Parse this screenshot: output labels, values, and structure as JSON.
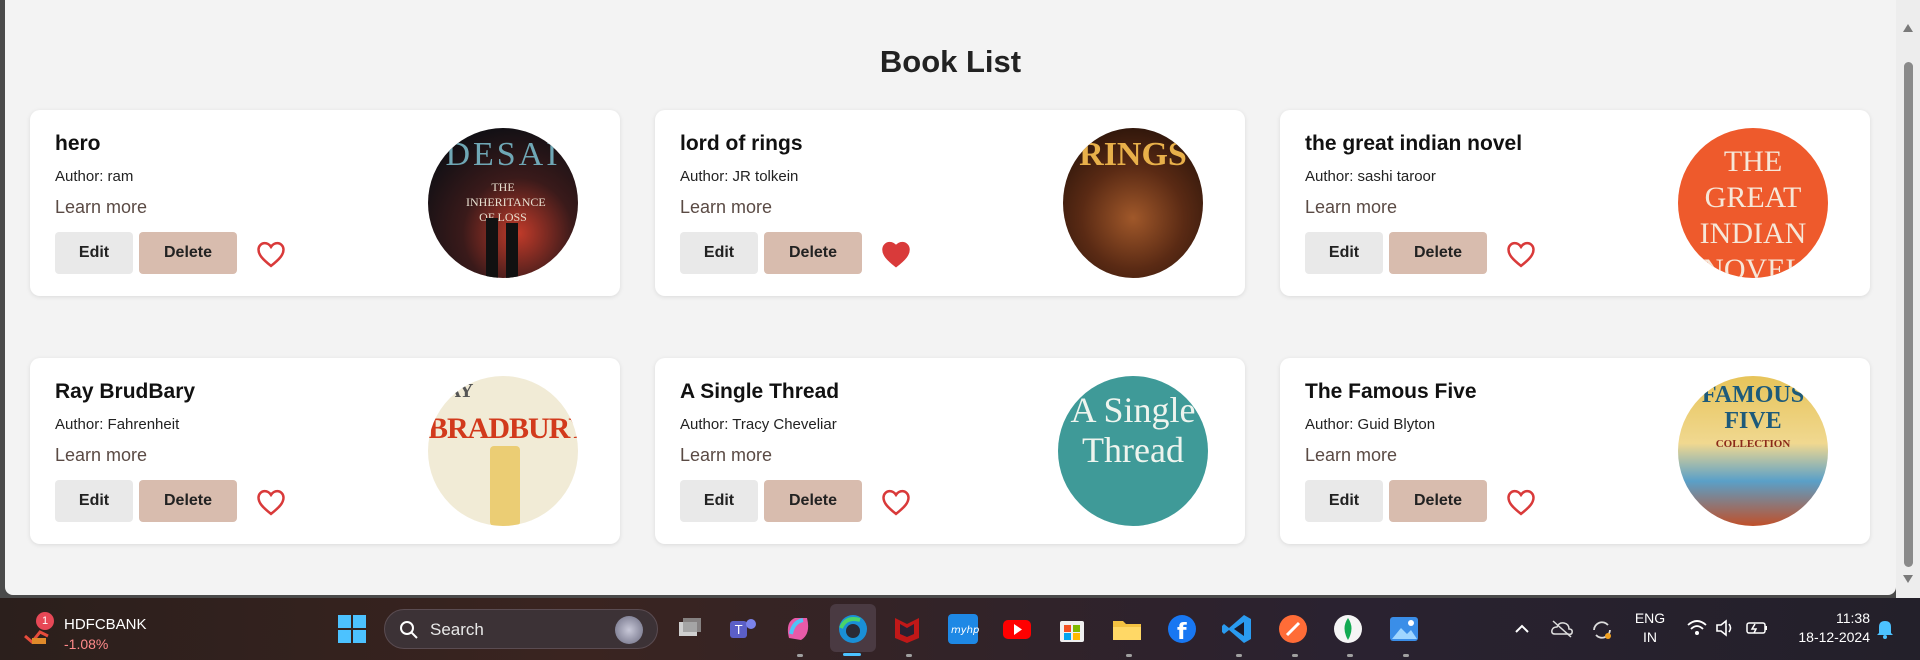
{
  "page": {
    "title": "Book List"
  },
  "books": [
    {
      "title": "hero",
      "author": "Author: ram",
      "learn_more": "Learn more",
      "edit": "Edit",
      "delete": "Delete",
      "favorite": false,
      "cover_text": "DESAI",
      "cover_sub": "THE INHERITANCE OF LOSS"
    },
    {
      "title": "lord of rings",
      "author": "Author: JR tolkein",
      "learn_more": "Learn more",
      "edit": "Edit",
      "delete": "Delete",
      "favorite": true,
      "cover_text": "RINGS",
      "cover_sub": ""
    },
    {
      "title": "the great indian novel",
      "author": "Author: sashi taroor",
      "learn_more": "Learn more",
      "edit": "Edit",
      "delete": "Delete",
      "favorite": false,
      "cover_text": "THE GREAT INDIAN NOVEL",
      "cover_sub": ""
    },
    {
      "title": "Ray BrudBary",
      "author": "Author: Fahrenheit",
      "learn_more": "Learn more",
      "edit": "Edit",
      "delete": "Delete",
      "favorite": false,
      "cover_text": "BRADBURY",
      "cover_sub": "RAY"
    },
    {
      "title": "A Single Thread",
      "author": "Author: Tracy Cheveliar",
      "learn_more": "Learn more",
      "edit": "Edit",
      "delete": "Delete",
      "favorite": false,
      "cover_text": "A Single Thread",
      "cover_sub": ""
    },
    {
      "title": "The Famous Five",
      "author": "Author: Guid Blyton",
      "learn_more": "Learn more",
      "edit": "Edit",
      "delete": "Delete",
      "favorite": false,
      "cover_text": "FAMOUS FIVE",
      "cover_sub": "COLLECTION"
    }
  ],
  "taskbar": {
    "stock_name": "HDFCBANK",
    "stock_change": "-1.08%",
    "stock_badge": "1",
    "search_placeholder": "Search",
    "language": "ENG",
    "region": "IN",
    "time": "11:38",
    "date": "18-12-2024"
  },
  "colors": {
    "heart": "#d93a3a",
    "delete_bg": "#d8bcae",
    "edit_bg": "#e9e9e9"
  }
}
